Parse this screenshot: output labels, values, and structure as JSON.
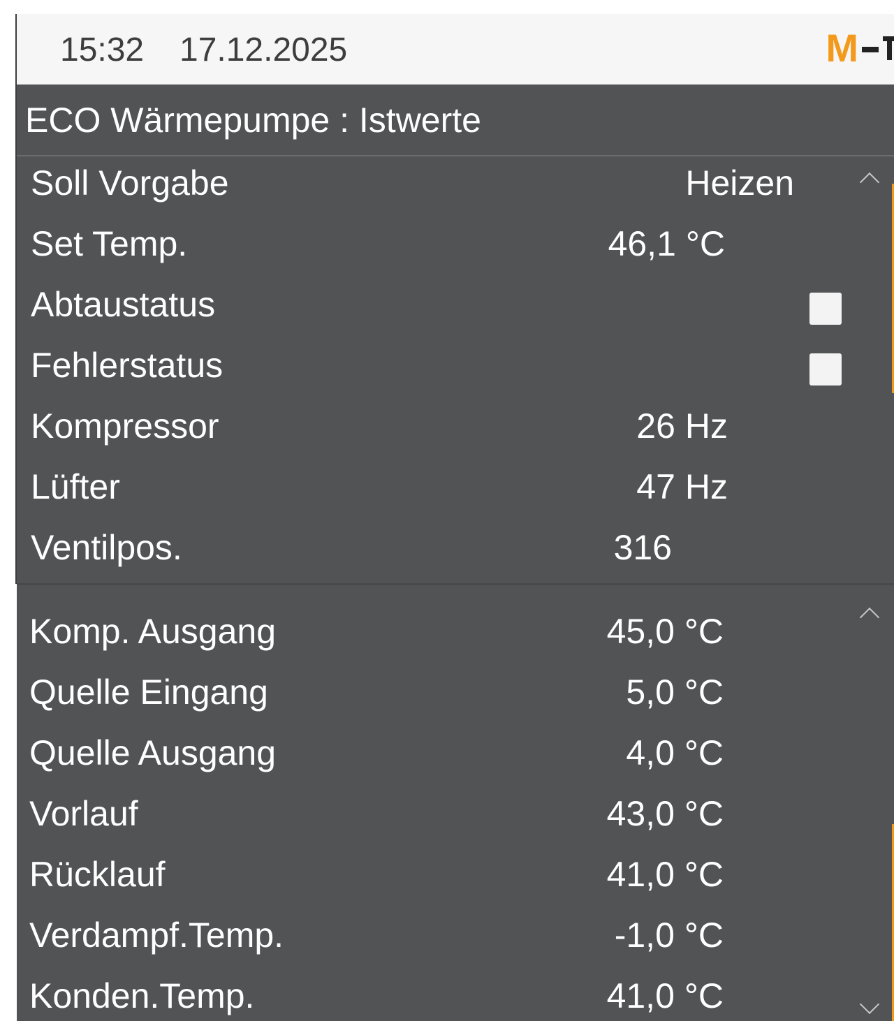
{
  "header": {
    "time": "15:32",
    "date": "17.12.2025",
    "logo_text": "M"
  },
  "page_title": "ECO Wärmepumpe : Istwerte",
  "panel_top": {
    "rows": [
      {
        "label": "Soll Vorgabe",
        "value": "Heizen",
        "unit": ""
      },
      {
        "label": "Set Temp.",
        "value": "46,1",
        "unit": "°C"
      },
      {
        "label": "Abtaustatus",
        "checked": false
      },
      {
        "label": "Fehlerstatus",
        "checked": false
      },
      {
        "label": "Kompressor",
        "value": "26",
        "unit": "Hz"
      },
      {
        "label": "Lüfter",
        "value": "47",
        "unit": "Hz"
      },
      {
        "label": "Ventilpos.",
        "value": "316",
        "unit": ""
      }
    ]
  },
  "panel_bottom": {
    "rows": [
      {
        "label": "Komp. Ausgang",
        "value": "45,0",
        "unit": "°C"
      },
      {
        "label": "Quelle Eingang",
        "value": "5,0",
        "unit": "°C"
      },
      {
        "label": "Quelle Ausgang",
        "value": "4,0",
        "unit": "°C"
      },
      {
        "label": "Vorlauf",
        "value": "43,0",
        "unit": "°C"
      },
      {
        "label": "Rücklauf",
        "value": "41,0",
        "unit": "°C"
      },
      {
        "label": "Verdampf.Temp.",
        "value": "-1,0",
        "unit": "°C"
      },
      {
        "label": "Konden.Temp.",
        "value": "41,0",
        "unit": "°C"
      }
    ]
  },
  "icons": {
    "scroll_up": "chevron-up-icon",
    "scroll_down": "chevron-down-icon",
    "checkbox": "checkbox-icon"
  },
  "colors": {
    "background": "#515355",
    "header_bg": "#f6f6f6",
    "accent": "#f39a1d",
    "text": "#ffffff"
  }
}
